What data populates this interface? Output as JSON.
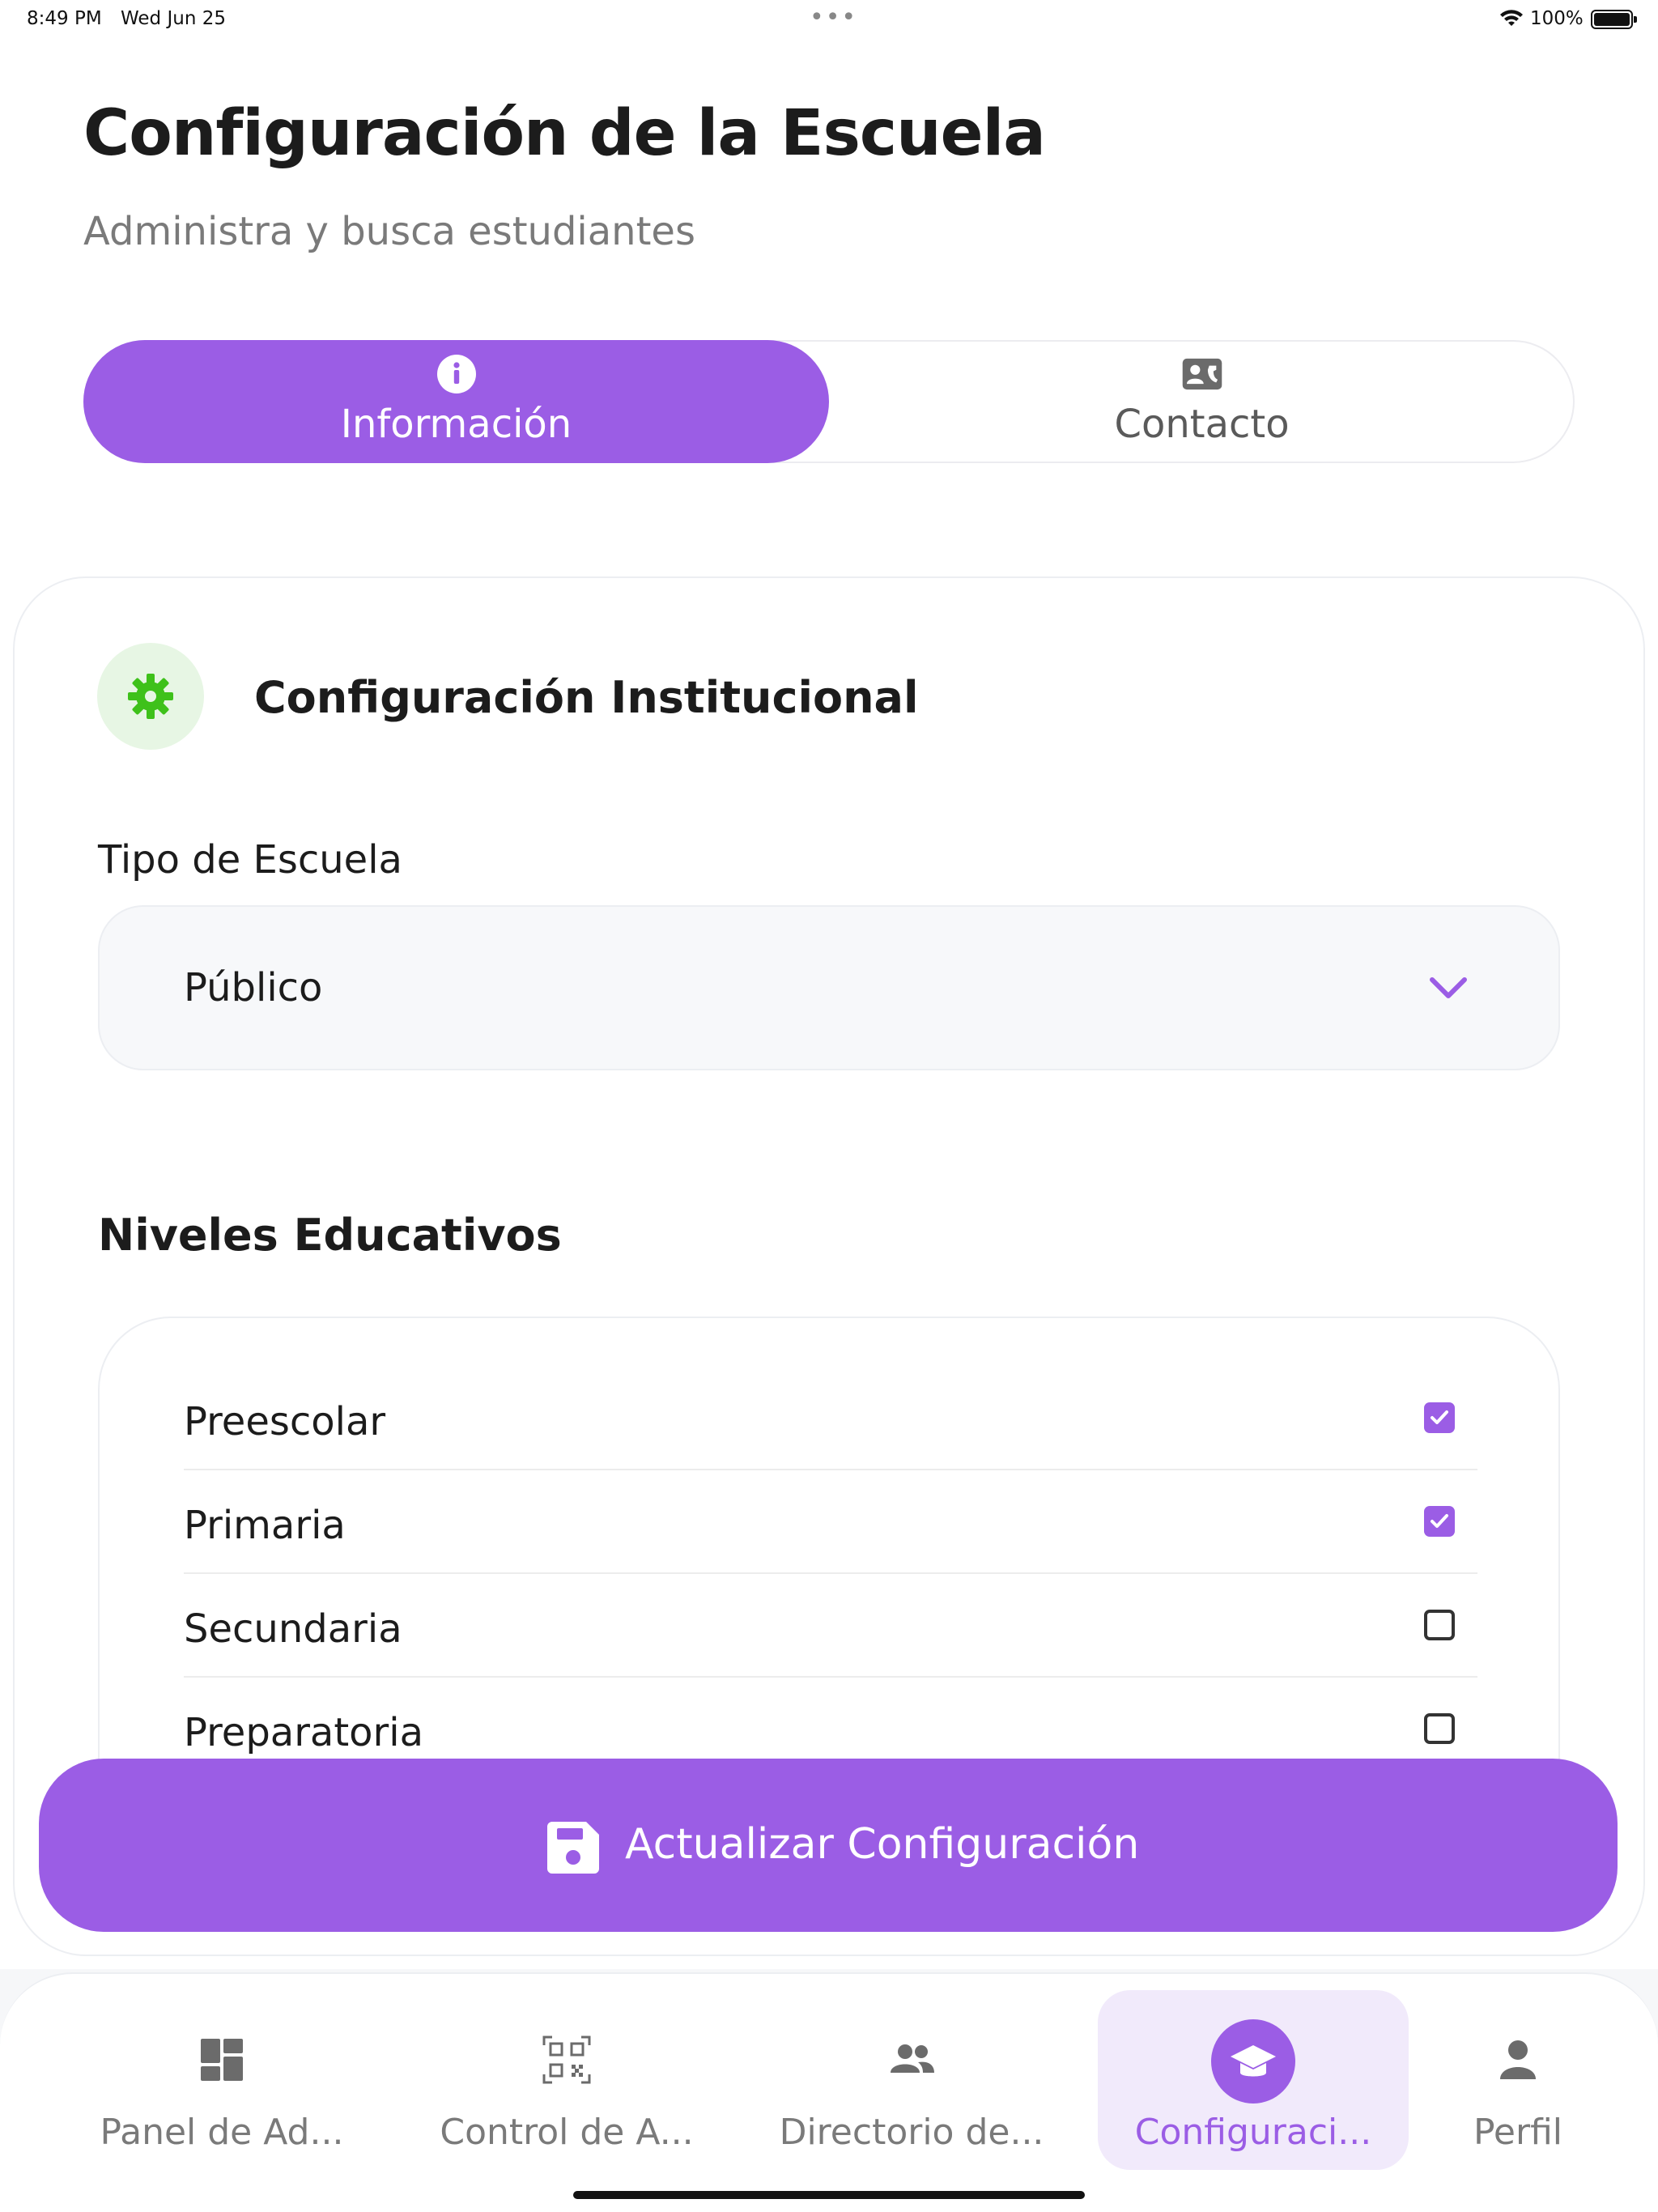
{
  "status_bar": {
    "time": "8:49 PM",
    "date": "Wed Jun 25",
    "dots": "•••",
    "battery": "100%"
  },
  "header": {
    "title": "Configuración de la Escuela",
    "subtitle": "Administra y busca estudiantes"
  },
  "tabs": [
    {
      "label": "Información",
      "icon": "info-icon",
      "active": true
    },
    {
      "label": "Contacto",
      "icon": "contact-card-icon",
      "active": false
    }
  ],
  "card": {
    "title": "Configuración Institucional",
    "icon": "gear-icon",
    "school_type": {
      "label": "Tipo de Escuela",
      "value": "Público"
    },
    "levels": {
      "title": "Niveles Educativos",
      "items": [
        {
          "label": "Preescolar",
          "checked": true
        },
        {
          "label": "Primaria",
          "checked": true
        },
        {
          "label": "Secundaria",
          "checked": false
        },
        {
          "label": "Preparatoria",
          "checked": false
        }
      ]
    }
  },
  "update_button": {
    "label": "Actualizar Configuración",
    "icon": "save-icon"
  },
  "bottom_nav": [
    {
      "label": "Panel de Ad...",
      "icon": "dashboard-icon",
      "active": false
    },
    {
      "label": "Control de A...",
      "icon": "qr-code-icon",
      "active": false
    },
    {
      "label": "Directorio de...",
      "icon": "users-icon",
      "active": false
    },
    {
      "label": "Configuraci...",
      "icon": "graduation-cap-icon",
      "active": true
    },
    {
      "label": "Perfil",
      "icon": "person-icon",
      "active": false
    }
  ],
  "colors": {
    "accent": "#9b5de5",
    "accent_light": "#f1eafb",
    "green_icon": "#3ec11a",
    "green_bg": "#e7f6e4",
    "muted": "#7a7a7a"
  }
}
